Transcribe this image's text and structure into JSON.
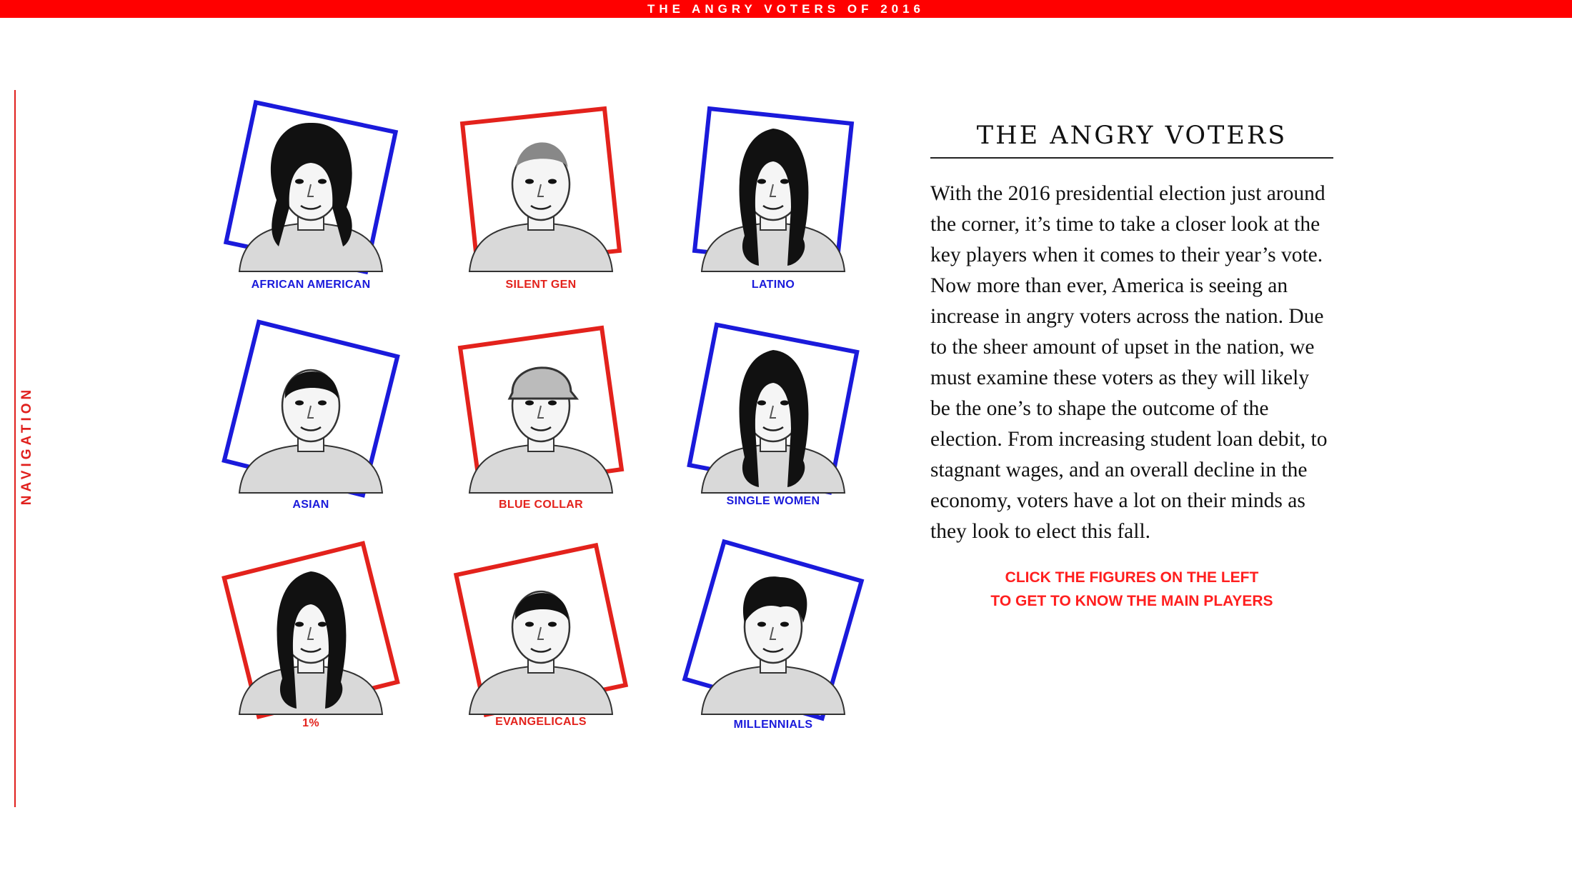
{
  "header": {
    "title": "THE ANGRY VOTERS OF 2016"
  },
  "navigation": {
    "label": "NAVIGATION"
  },
  "figures": [
    {
      "label": "AFRICAN AMERICAN",
      "color": "#1a1adb",
      "hair": "curly"
    },
    {
      "label": "SILENT GEN",
      "color": "#e3221c",
      "hair": "old"
    },
    {
      "label": "LATINO",
      "color": "#1a1adb",
      "hair": "long"
    },
    {
      "label": "ASIAN",
      "color": "#1a1adb",
      "hair": "short"
    },
    {
      "label": "BLUE COLLAR",
      "color": "#e3221c",
      "hair": "cap"
    },
    {
      "label": "SINGLE WOMEN",
      "color": "#1a1adb",
      "hair": "long"
    },
    {
      "label": "1%",
      "color": "#e3221c",
      "hair": "long"
    },
    {
      "label": "EVANGELICALS",
      "color": "#e3221c",
      "hair": "short"
    },
    {
      "label": "MILLENNIALS",
      "color": "#1a1adb",
      "hair": "messy"
    }
  ],
  "article": {
    "heading": "THE ANGRY VOTERS",
    "body": "With the 2016 presidential election just around the corner, it’s time to take a closer look at the key players when it comes to their year’s vote. Now more than ever, America is seeing an increase in angry voters across the nation. Due to the sheer amount of upset in the nation, we must examine these voters as they will likely be the one’s to shape the outcome of the election. From increasing student loan debit, to stagnant wages, and an overall decline in the economy, voters have a lot on their minds as they look to elect this fall.",
    "cta_line1": "CLICK THE FIGURES ON THE LEFT",
    "cta_line2": "TO GET TO KNOW THE MAIN PLAYERS"
  }
}
